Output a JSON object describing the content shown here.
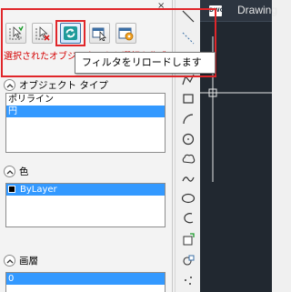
{
  "panel": {
    "close_glyph": "×",
    "toolbar_icons": [
      "select-filter-add-icon",
      "select-filter-remove-icon",
      "reload-filter-icon",
      "select-object-icon",
      "filter-settings-icon"
    ],
    "caption": "選択されたオブジェクトから選択を作成"
  },
  "tooltip": {
    "text": "フィルタをリロードします"
  },
  "sections": {
    "object_type": {
      "title": "オブジェクト タイプ",
      "items": [
        "ポリライン",
        "円"
      ],
      "selected_index": 1
    },
    "color": {
      "title": "色",
      "items": [
        "ByLayer"
      ],
      "selected_index": 0,
      "swatch_color": "#000000"
    },
    "layer": {
      "title": "画層",
      "items": [
        "0"
      ],
      "selected_index": 0
    }
  },
  "drawing": {
    "tab_icon_label": "DWG",
    "title": "Drawing"
  },
  "draw_tools": [
    "line-icon",
    "construction-line-icon",
    "polyline-icon",
    "polygon-icon",
    "rectangle-icon",
    "arc-icon",
    "circle-icon",
    "cloud-icon",
    "spline-icon",
    "ellipse-icon",
    "ellipse-arc-icon",
    "insert-block-icon",
    "make-block-icon",
    "point-icon"
  ],
  "colors": {
    "highlight": "#e0262a",
    "selection": "#3399ff",
    "caption": "#d40000",
    "drawing_bg": "#212830"
  }
}
